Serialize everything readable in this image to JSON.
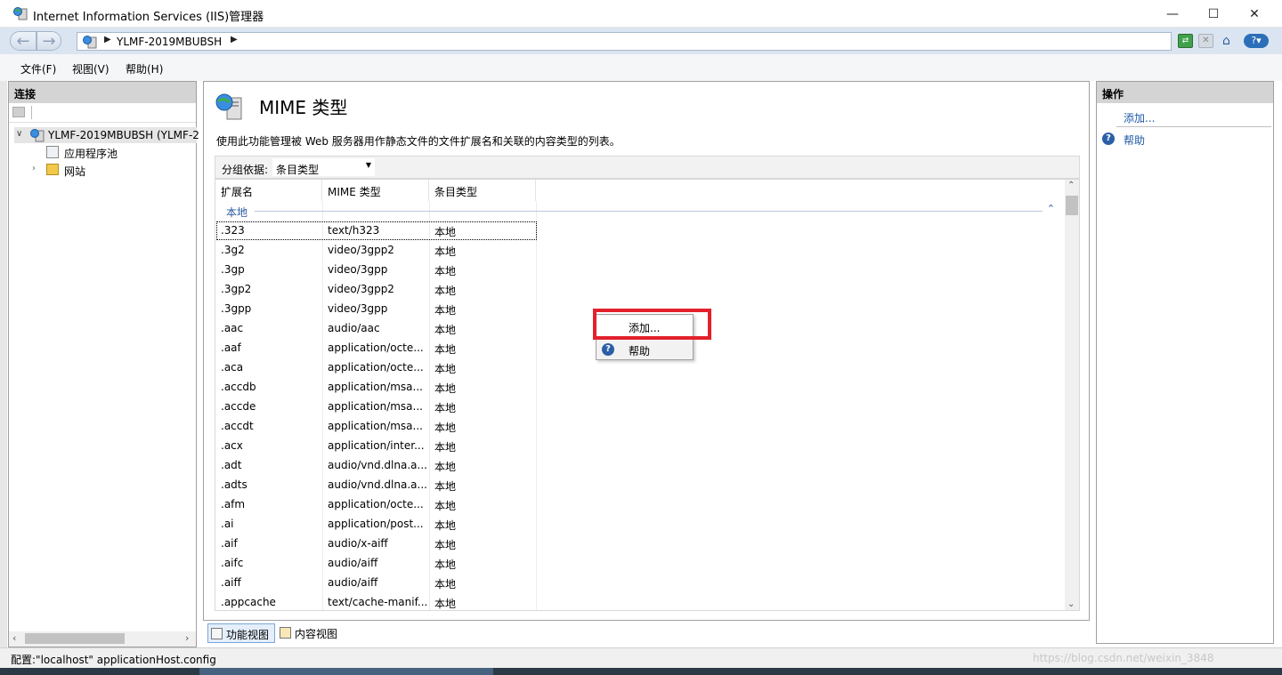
{
  "window": {
    "title": "Internet Information Services (IIS)管理器",
    "controls": {
      "minimize": "—",
      "maximize": "☐",
      "close": "✕"
    }
  },
  "address": {
    "crumb": "YLMF-2019MBUBSH"
  },
  "menu": {
    "file": "文件(F)",
    "view": "视图(V)",
    "help": "帮助(H)"
  },
  "connections": {
    "header": "连接",
    "root": "YLMF-2019MBUBSH (YLMF-2",
    "app_pools": "应用程序池",
    "sites": "网站"
  },
  "feature": {
    "title": "MIME 类型",
    "description": "使用此功能管理被 Web 服务器用作静态文件的文件扩展名和关联的内容类型的列表。",
    "group_by_label": "分组依据:",
    "group_by_value": "条目类型",
    "columns": [
      "扩展名",
      "MIME 类型",
      "条目类型"
    ],
    "group_name": "本地",
    "rows": [
      {
        "ext": ".323",
        "mime": "text/h323",
        "type": "本地"
      },
      {
        "ext": ".3g2",
        "mime": "video/3gpp2",
        "type": "本地"
      },
      {
        "ext": ".3gp",
        "mime": "video/3gpp",
        "type": "本地"
      },
      {
        "ext": ".3gp2",
        "mime": "video/3gpp2",
        "type": "本地"
      },
      {
        "ext": ".3gpp",
        "mime": "video/3gpp",
        "type": "本地"
      },
      {
        "ext": ".aac",
        "mime": "audio/aac",
        "type": "本地"
      },
      {
        "ext": ".aaf",
        "mime": "application/octe...",
        "type": "本地"
      },
      {
        "ext": ".aca",
        "mime": "application/octe...",
        "type": "本地"
      },
      {
        "ext": ".accdb",
        "mime": "application/msa...",
        "type": "本地"
      },
      {
        "ext": ".accde",
        "mime": "application/msa...",
        "type": "本地"
      },
      {
        "ext": ".accdt",
        "mime": "application/msa...",
        "type": "本地"
      },
      {
        "ext": ".acx",
        "mime": "application/inter...",
        "type": "本地"
      },
      {
        "ext": ".adt",
        "mime": "audio/vnd.dlna.a...",
        "type": "本地"
      },
      {
        "ext": ".adts",
        "mime": "audio/vnd.dlna.a...",
        "type": "本地"
      },
      {
        "ext": ".afm",
        "mime": "application/octe...",
        "type": "本地"
      },
      {
        "ext": ".ai",
        "mime": "application/post...",
        "type": "本地"
      },
      {
        "ext": ".aif",
        "mime": "audio/x-aiff",
        "type": "本地"
      },
      {
        "ext": ".aifc",
        "mime": "audio/aiff",
        "type": "本地"
      },
      {
        "ext": ".aiff",
        "mime": "audio/aiff",
        "type": "本地"
      },
      {
        "ext": ".appcache",
        "mime": "text/cache-manif...",
        "type": "本地"
      }
    ]
  },
  "view_tabs": {
    "features": "功能视图",
    "content": "内容视图"
  },
  "actions": {
    "header": "操作",
    "add": "添加...",
    "help": "帮助"
  },
  "context_menu": {
    "add": "添加...",
    "help": "帮助"
  },
  "status": {
    "text": "配置:\"localhost\" applicationHost.config",
    "watermark": "https://blog.csdn.net/weixin_3848"
  },
  "colors": {
    "link": "#1f5aa6",
    "highlight_box": "#e3202c",
    "group_label": "#2c5aa0"
  }
}
